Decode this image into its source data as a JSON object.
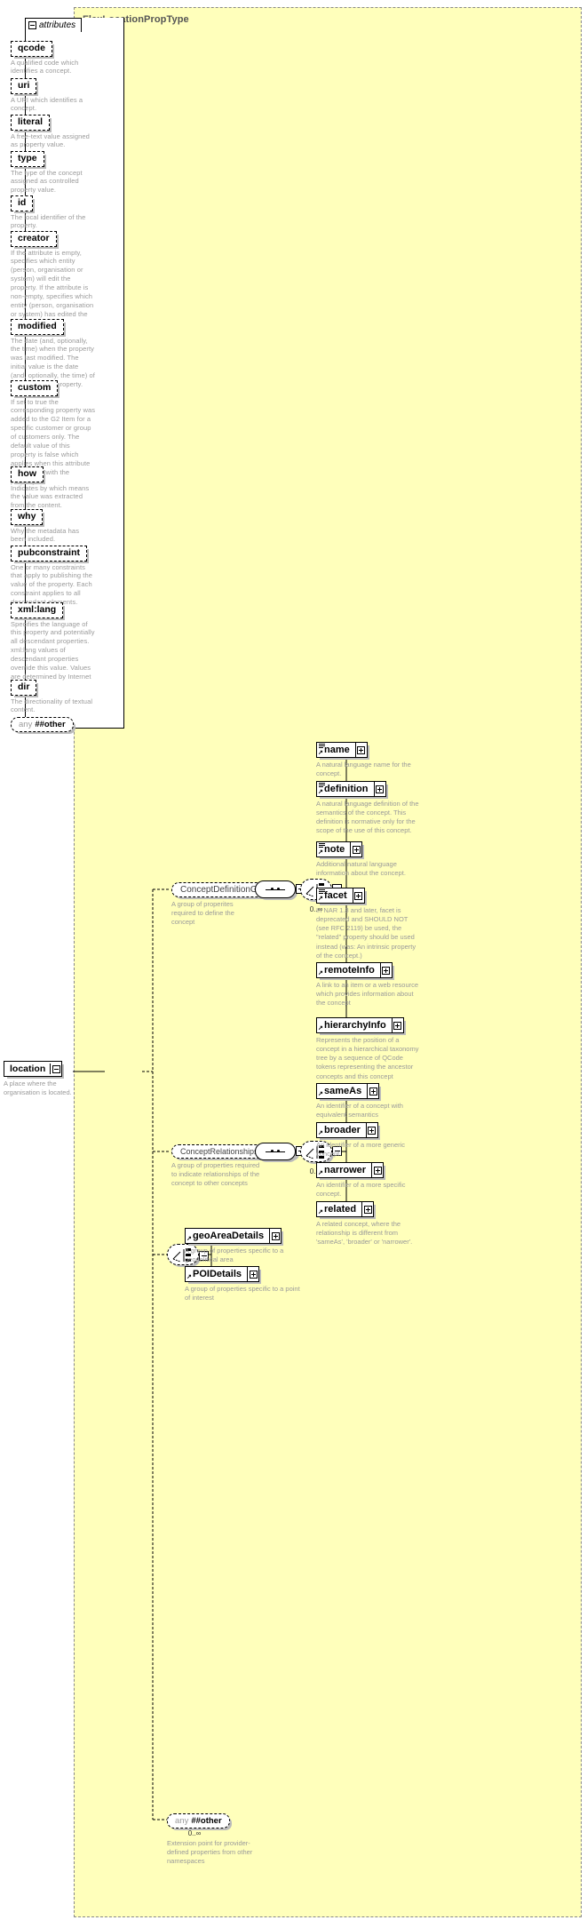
{
  "type_panel": {
    "title": "FlexLocationPropType"
  },
  "attributes_section": {
    "label": "attributes",
    "toggle_icon": "minus-square-icon",
    "items": [
      {
        "name": "qcode",
        "desc": "A qualified code which identifies a concept."
      },
      {
        "name": "uri",
        "desc": "A URI which identifies a concept."
      },
      {
        "name": "literal",
        "desc": "A free-text value assigned as property value."
      },
      {
        "name": "type",
        "desc": "The type of the concept assigned as controlled property value."
      },
      {
        "name": "id",
        "desc": "The local identifier of the property."
      },
      {
        "name": "creator",
        "desc": "If the attribute is empty, specifies which entity (person, organisation or system) will edit the property. If the attribute is non-empty, specifies which entity (person, organisation or system) has edited the property."
      },
      {
        "name": "modified",
        "desc": "The date (and, optionally, the time) when the property was last modified. The initial value is the date (and, optionally, the time) of creation of the property."
      },
      {
        "name": "custom",
        "desc": "If set to true the corresponding property was added to the G2 Item for a specific customer or group of customers only. The default value of this property is false which applies when this attribute is not used with the property."
      },
      {
        "name": "how",
        "desc": "Indicates by which means the value was extracted from the content."
      },
      {
        "name": "why",
        "desc": "Why the metadata has been included."
      },
      {
        "name": "pubconstraint",
        "desc": "One or many constraints that apply to publishing the value of the property. Each constraint applies to all descendant elements."
      },
      {
        "name": "xml:lang",
        "desc": "Specifies the language of this property and potentially all descendant properties. xml:lang values of descendant properties override this value. Values are determined by Internet BCP 47."
      },
      {
        "name": "dir",
        "desc": "The directionality of textual content."
      }
    ],
    "any_other": {
      "any_word": "any",
      "other_word": "##other"
    }
  },
  "root_element": {
    "name": "location",
    "desc": "A place where the organisation is located.",
    "toggle_icon": "minus-square-icon"
  },
  "concept_definition_group": {
    "name": "ConceptDefinitionGroup",
    "desc": "A group of properites required to define the concept",
    "compositor": "sequence",
    "choice_multiplicity": "0..∞",
    "children": [
      {
        "name": "name",
        "desc": "A natural language name for the concept.",
        "toggle_icon": "plus-square-icon"
      },
      {
        "name": "definition",
        "desc": "A natural language definition of the semantics of the concept. This definition is normative only for the scope of the use of this concept.",
        "toggle_icon": "plus-square-icon"
      },
      {
        "name": "note",
        "desc": "Additional natural language information about the concept.",
        "toggle_icon": "plus-square-icon"
      },
      {
        "name": "facet",
        "desc": "In NAR 1.8 and later, facet is deprecated and SHOULD NOT (see RFC 2119) be used, the \"related\" property should be used instead (was: An intrinsic property of the concept.)",
        "toggle_icon": "plus-square-icon"
      },
      {
        "name": "remoteInfo",
        "desc": "A link to an item or a web resource which provides information about the concept",
        "toggle_icon": "plus-square-icon"
      },
      {
        "name": "hierarchyInfo",
        "desc": "Represents the position of a concept in a hierarchical taxonomy tree by a sequence of QCode tokens representing the ancestor concepts and this concept",
        "toggle_icon": "plus-square-icon"
      }
    ]
  },
  "concept_relationships_group": {
    "name": "ConceptRelationshipsGroup",
    "desc": "A group of properties required to indicate relationships of the concept to other concepts",
    "compositor": "sequence",
    "choice_multiplicity": "0..∞",
    "children": [
      {
        "name": "sameAs",
        "desc": "An identifier of a concept with equivalent semantics",
        "toggle_icon": "plus-square-icon"
      },
      {
        "name": "broader",
        "desc": "An identifier of a more generic concept.",
        "toggle_icon": "plus-square-icon"
      },
      {
        "name": "narrower",
        "desc": "An identifier of a more specific concept.",
        "toggle_icon": "plus-square-icon"
      },
      {
        "name": "related",
        "desc": "A related concept, where the relationship is different from 'sameAs', 'broader' or 'narrower'.",
        "toggle_icon": "plus-square-icon"
      }
    ]
  },
  "details_choice": {
    "children": [
      {
        "name": "geoAreaDetails",
        "desc": "A group of properties specific to a geopolitical area",
        "toggle_icon": "plus-square-icon"
      },
      {
        "name": "POIDetails",
        "desc": "A group of properties specific to a point of interest",
        "toggle_icon": "plus-square-icon"
      }
    ]
  },
  "any_other_bottom": {
    "any_word": "any",
    "other_word": "##other",
    "multiplicity": "0..∞",
    "desc": "Extension point for provider-defined properties from other namespaces"
  },
  "colors": {
    "panel_background": "#ffffbb",
    "node_background": "#ffffff",
    "description_text": "#9a9a9a",
    "line": "#000000",
    "shadow": "#bbbbbb",
    "title_text": "#555555"
  }
}
